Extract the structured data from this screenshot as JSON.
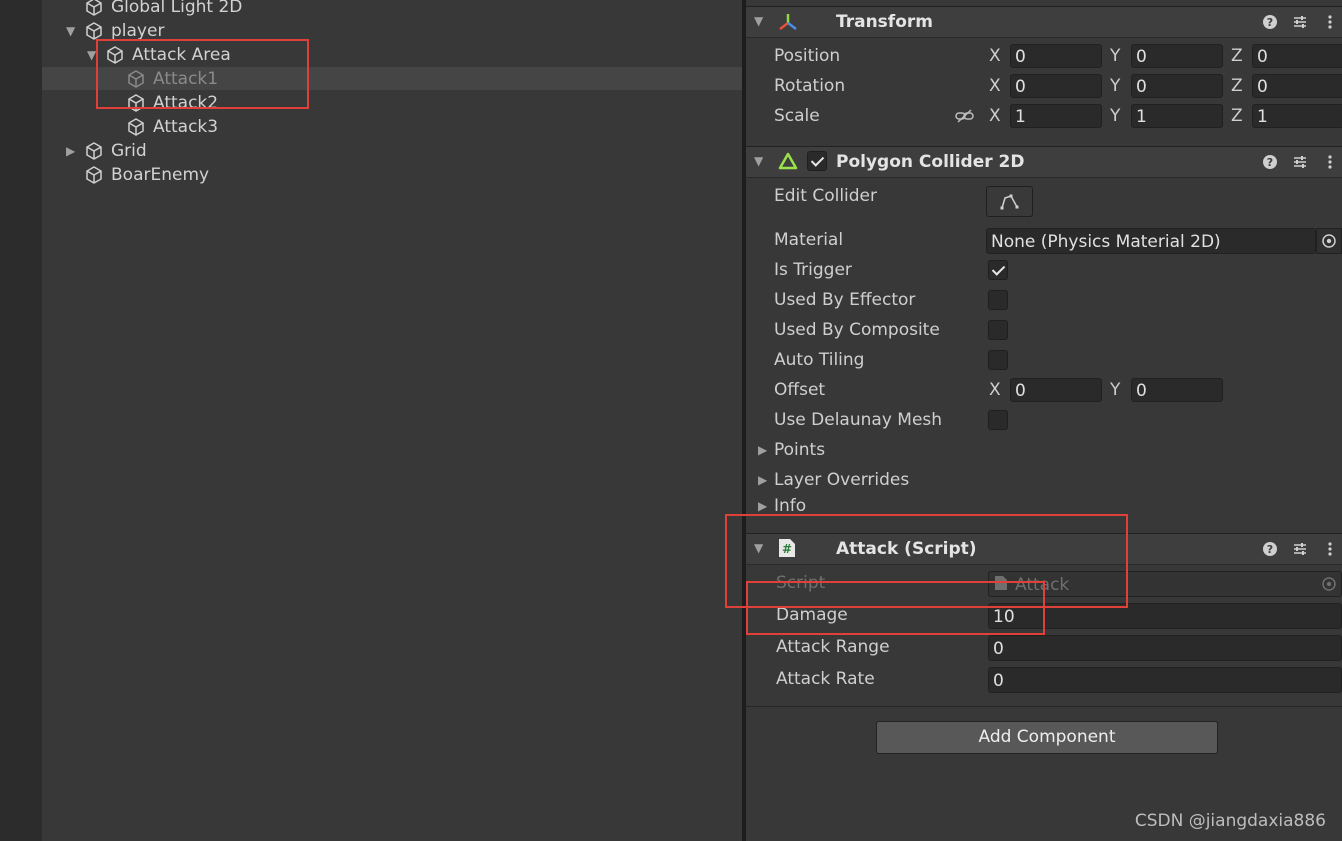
{
  "hierarchy": {
    "items": [
      {
        "label": "Global Light 2D"
      },
      {
        "label": "player"
      },
      {
        "label": "Attack Area"
      },
      {
        "label": "Attack1"
      },
      {
        "label": "Attack2"
      },
      {
        "label": "Attack3"
      },
      {
        "label": "Grid"
      },
      {
        "label": "BoarEnemy"
      }
    ]
  },
  "transform": {
    "title": "Transform",
    "rows": [
      {
        "label": "Position",
        "x": "0",
        "y": "0",
        "z": "0"
      },
      {
        "label": "Rotation",
        "x": "0",
        "y": "0",
        "z": "0"
      },
      {
        "label": "Scale",
        "x": "1",
        "y": "1",
        "z": "1"
      }
    ],
    "axes": {
      "x": "X",
      "y": "Y",
      "z": "Z"
    }
  },
  "collider": {
    "title": "Polygon Collider 2D",
    "enabled": true,
    "edit_collider": "Edit Collider",
    "material_label": "Material",
    "material_value": "None (Physics Material 2D)",
    "is_trigger": "Is Trigger",
    "used_by_effector": "Used By Effector",
    "used_by_composite": "Used By Composite",
    "auto_tiling": "Auto Tiling",
    "offset_label": "Offset",
    "offset_x": "0",
    "offset_y": "0",
    "delaunay": "Use Delaunay Mesh",
    "points": "Points",
    "layer_overrides": "Layer Overrides",
    "info": "Info"
  },
  "script": {
    "title": "Attack (Script)",
    "script_label": "Script",
    "script_value": "Attack",
    "damage_label": "Damage",
    "damage_value": "10",
    "range_label": "Attack Range",
    "range_value": "0",
    "rate_label": "Attack Rate",
    "rate_value": "0"
  },
  "add_component": "Add Component",
  "watermark": "CSDN @jiangdaxia886",
  "colors": {
    "highlight_box": "#e0403a",
    "collider_icon": "#9be24a",
    "transform_red": "#e8503a",
    "transform_green": "#8bd840",
    "transform_blue": "#4a8ee8"
  }
}
